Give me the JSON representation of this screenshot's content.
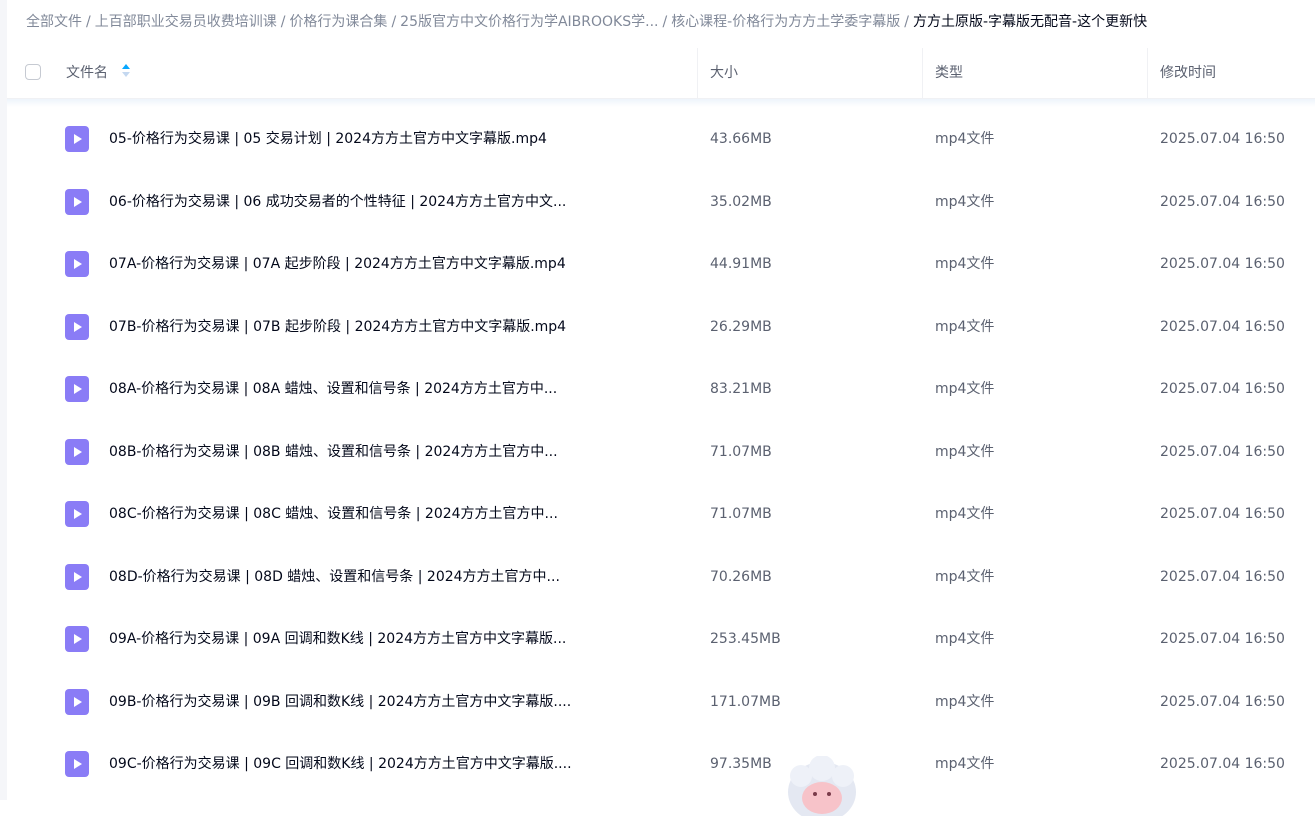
{
  "breadcrumb": [
    "全部文件",
    "上百部职业交易员收费培训课",
    "价格行为课合集",
    "25版官方中文价格行为学AIBROOKS学...",
    "核心课程-价格行为方方土学委字幕版",
    "方方土原版-字幕版无配音-这个更新快"
  ],
  "breadcrumb_separator": "/",
  "table": {
    "columns": {
      "name": "文件名",
      "size": "大小",
      "type": "类型",
      "modified": "修改时间"
    },
    "sort": {
      "column": "name",
      "direction": "ascending"
    },
    "rows": [
      {
        "name": "05-价格行为交易课 | 05 交易计划 |  2024方方土官方中文字幕版.mp4",
        "size": "43.66MB",
        "type": "mp4文件",
        "modified": "2025.07.04 16:50"
      },
      {
        "name": "06-价格行为交易课 | 06 成功交易者的个性特征 |  2024方方土官方中文...",
        "size": "35.02MB",
        "type": "mp4文件",
        "modified": "2025.07.04 16:50"
      },
      {
        "name": "07A-价格行为交易课 | 07A 起步阶段 |  2024方方土官方中文字幕版.mp4",
        "size": "44.91MB",
        "type": "mp4文件",
        "modified": "2025.07.04 16:50"
      },
      {
        "name": "07B-价格行为交易课 | 07B 起步阶段 |  2024方方土官方中文字幕版.mp4",
        "size": "26.29MB",
        "type": "mp4文件",
        "modified": "2025.07.04 16:50"
      },
      {
        "name": "08A-价格行为交易课 |  08A 蜡烛、设置和信号条 |  2024方方土官方中...",
        "size": "83.21MB",
        "type": "mp4文件",
        "modified": "2025.07.04 16:50"
      },
      {
        "name": "08B-价格行为交易课 |  08B 蜡烛、设置和信号条 |  2024方方土官方中...",
        "size": "71.07MB",
        "type": "mp4文件",
        "modified": "2025.07.04 16:50"
      },
      {
        "name": "08C-价格行为交易课 |  08C 蜡烛、设置和信号条 |  2024方方土官方中...",
        "size": "71.07MB",
        "type": "mp4文件",
        "modified": "2025.07.04 16:50"
      },
      {
        "name": "08D-价格行为交易课 |  08D 蜡烛、设置和信号条 |  2024方方土官方中...",
        "size": "70.26MB",
        "type": "mp4文件",
        "modified": "2025.07.04 16:50"
      },
      {
        "name": "09A-价格行为交易课 | 09A 回调和数K线 |  2024方方土官方中文字幕版...",
        "size": "253.45MB",
        "type": "mp4文件",
        "modified": "2025.07.04 16:50"
      },
      {
        "name": "09B-价格行为交易课 | 09B 回调和数K线 |  2024方方土官方中文字幕版....",
        "size": "171.07MB",
        "type": "mp4文件",
        "modified": "2025.07.04 16:50"
      },
      {
        "name": "09C-价格行为交易课 | 09C 回调和数K线 |  2024方方土官方中文字幕版....",
        "size": "97.35MB",
        "type": "mp4文件",
        "modified": "2025.07.04 16:50"
      }
    ]
  },
  "icons": {
    "file": "video-file-icon",
    "sort": "sort-arrows-icon",
    "mascot": "mascot-icon"
  },
  "colors": {
    "video_icon": "#8a7cf6",
    "sort_active": "#06a7ff",
    "text_primary": "#03081a",
    "text_secondary": "#5b6170",
    "breadcrumb": "#818999"
  }
}
